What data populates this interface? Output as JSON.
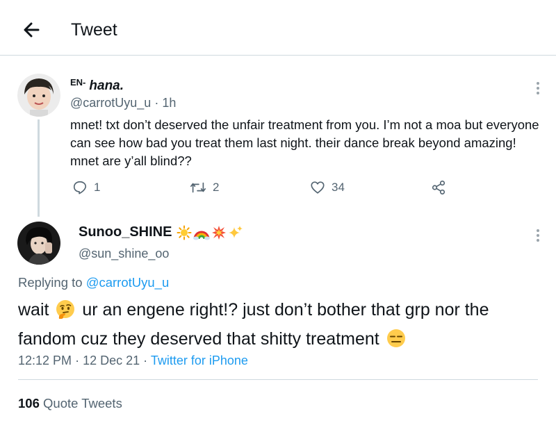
{
  "header": {
    "title": "Tweet",
    "back_icon": "arrow-left-icon"
  },
  "tweet1": {
    "name_prefix": "EN-",
    "name": "hana.",
    "handle": "@carrotUyu_u",
    "separator": "·",
    "time": "1h",
    "text": "mnet! txt don’t deserved the unfair treatment from you. I’m not a moa but everyone can see how bad you treat them last night. their dance break beyond amazing! mnet are y’all blind??",
    "replies": "1",
    "retweets": "2",
    "likes": "34"
  },
  "tweet2": {
    "name": "Sunoo_SHINE",
    "name_emojis": [
      "sun-emoji",
      "rainbow-emoji",
      "collision-emoji",
      "sparkles-emoji"
    ],
    "handle": "@sun_shine_oo",
    "replying_prefix": "Replying to",
    "replying_to": "@carrotUyu_u",
    "text_part1": "wait",
    "text_part2": "ur an engene right!? just don’t bother that grp nor the fandom cuz they deserved that shitty treatment",
    "text_emojis": [
      "thinking-face-emoji",
      "expressionless-face-emoji"
    ],
    "time": "12:12 PM",
    "sep1": "·",
    "date": "12 Dec 21",
    "sep2": "·",
    "source": "Twitter for iPhone"
  },
  "quotes": {
    "count": "106",
    "label": "Quote Tweets"
  },
  "colors": {
    "accent": "#1d9bf0",
    "text": "#0f1419",
    "muted": "#536471",
    "border": "#cfd9de"
  }
}
